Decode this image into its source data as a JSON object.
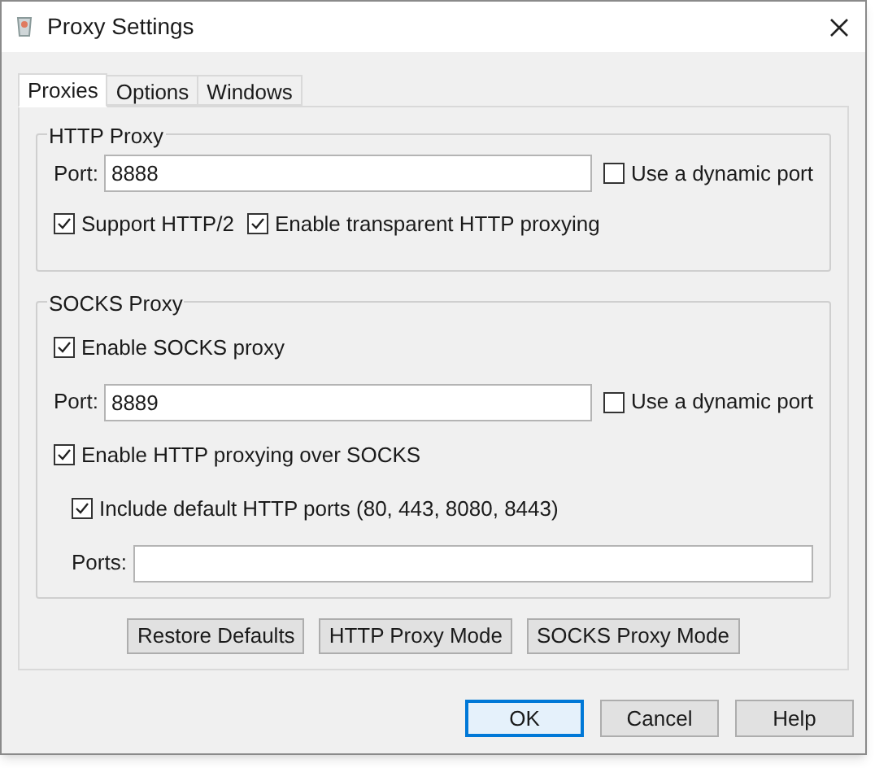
{
  "window": {
    "title": "Proxy Settings"
  },
  "tabs": [
    {
      "label": "Proxies",
      "selected": true
    },
    {
      "label": "Options",
      "selected": false
    },
    {
      "label": "Windows",
      "selected": false
    }
  ],
  "http_proxy": {
    "title": "HTTP Proxy",
    "port_label": "Port:",
    "port": "8888",
    "dynamic_port": {
      "label": "Use a dynamic port",
      "checked": false
    },
    "options": [
      {
        "label": "Support HTTP/2",
        "checked": true
      },
      {
        "label": "Enable transparent HTTP proxying",
        "checked": true
      }
    ]
  },
  "socks_proxy": {
    "title": "SOCKS Proxy",
    "enable": {
      "label": "Enable SOCKS proxy",
      "checked": true
    },
    "port_label": "Port:",
    "port": "8889",
    "dynamic_port": {
      "label": "Use a dynamic port",
      "checked": false
    },
    "http_over_socks": {
      "label": "Enable HTTP proxying over SOCKS",
      "checked": true
    },
    "include_default": {
      "label": "Include default HTTP ports (80, 443, 8080, 8443)",
      "checked": true
    },
    "ports_label": "Ports:"
  },
  "mode_buttons": [
    "Restore Defaults",
    "HTTP Proxy Mode",
    "SOCKS Proxy Mode"
  ],
  "dialog_buttons": [
    {
      "label": "OK",
      "default": true
    },
    {
      "label": "Cancel",
      "default": false
    },
    {
      "label": "Help",
      "default": false
    }
  ]
}
